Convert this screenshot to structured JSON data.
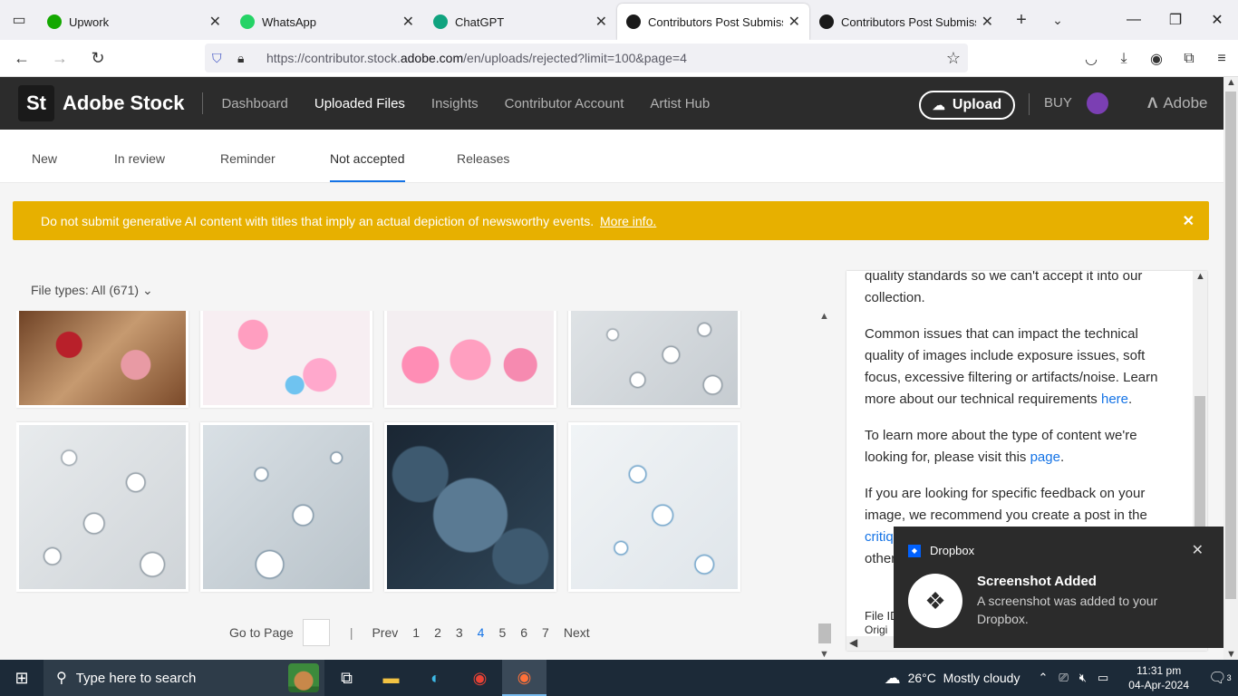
{
  "browser": {
    "tabs": [
      {
        "title": "Upwork",
        "icon": "upwork-icon",
        "color": "#14a800",
        "active": false
      },
      {
        "title": "WhatsApp",
        "icon": "whatsapp-icon",
        "color": "#25d366",
        "active": false
      },
      {
        "title": "ChatGPT",
        "icon": "chatgpt-icon",
        "color": "#10a37f",
        "active": false
      },
      {
        "title": "Contributors Post Submission",
        "icon": "adobe-stock-icon",
        "color": "#1a1a1a",
        "active": true
      },
      {
        "title": "Contributors Post Submission",
        "icon": "adobe-stock-icon",
        "color": "#1a1a1a",
        "active": false
      }
    ],
    "url_prefix": "https://contributor.stock.",
    "url_domain": "adobe.com",
    "url_suffix": "/en/uploads/rejected?limit=100&page=4"
  },
  "header": {
    "logo": "St",
    "brand": "Adobe Stock",
    "nav": [
      {
        "label": "Dashboard",
        "selected": false
      },
      {
        "label": "Uploaded Files",
        "selected": true
      },
      {
        "label": "Insights",
        "selected": false
      },
      {
        "label": "Contributor Account",
        "selected": false
      },
      {
        "label": "Artist Hub",
        "selected": false
      }
    ],
    "upload_label": "Upload",
    "buy_label": "BUY",
    "adobe_label": "Adobe"
  },
  "subtabs": [
    {
      "label": "New",
      "selected": false
    },
    {
      "label": "In review",
      "selected": false
    },
    {
      "label": "Reminder",
      "selected": false
    },
    {
      "label": "Not accepted",
      "selected": true
    },
    {
      "label": "Releases",
      "selected": false
    }
  ],
  "banner": {
    "message": "Do not submit generative AI content with titles that imply an actual depiction of newsworthy events.",
    "link": "More info.",
    "color": "#e7b000"
  },
  "file_types": "File types: All (671)",
  "thumbnails": [
    {
      "name": "hearts-vintage",
      "style": "img-hearts"
    },
    {
      "name": "pink-cake-gifts",
      "style": "img-cake1"
    },
    {
      "name": "pink-cakes-candles",
      "style": "img-cake2"
    },
    {
      "name": "water-drops-1",
      "style": "img-drops"
    },
    {
      "name": "water-drops-2",
      "style": "img-drops2"
    },
    {
      "name": "water-drops-3",
      "style": "img-drops3"
    },
    {
      "name": "blue-stone-hearts",
      "style": "img-blueheart"
    },
    {
      "name": "water-drops-4",
      "style": "img-drops4"
    }
  ],
  "pager": {
    "goto_label": "Go to Page",
    "prev": "Prev",
    "pages": [
      "1",
      "2",
      "3",
      "4",
      "5",
      "6",
      "7"
    ],
    "current": "4",
    "next": "Next"
  },
  "panel": {
    "p1": "quality standards so we can't accept it into our collection.",
    "p2": "Common issues that can impact the technical quality of images include exposure issues, soft focus, excessive filtering or artifacts/noise. Learn more about our technical requirements ",
    "p2_link": "here",
    "p3": "To learn more about the type of content we're looking for, please visit this ",
    "p3_link": "page",
    "p4": "If you are looking for specific feedback on your image, we recommend you create a post in the ",
    "p4_link": "critiq",
    "p4_tail": "other",
    "file_id": "File ID",
    "orig": "Origi"
  },
  "toast": {
    "app": "Dropbox",
    "title": "Screenshot Added",
    "body": "A screenshot was added to your Dropbox."
  },
  "taskbar": {
    "search_placeholder": "Type here to search",
    "weather_temp": "26°C",
    "weather_text": "Mostly cloudy",
    "time": "11:31 pm",
    "date": "04-Apr-2024",
    "notifications": "3"
  }
}
